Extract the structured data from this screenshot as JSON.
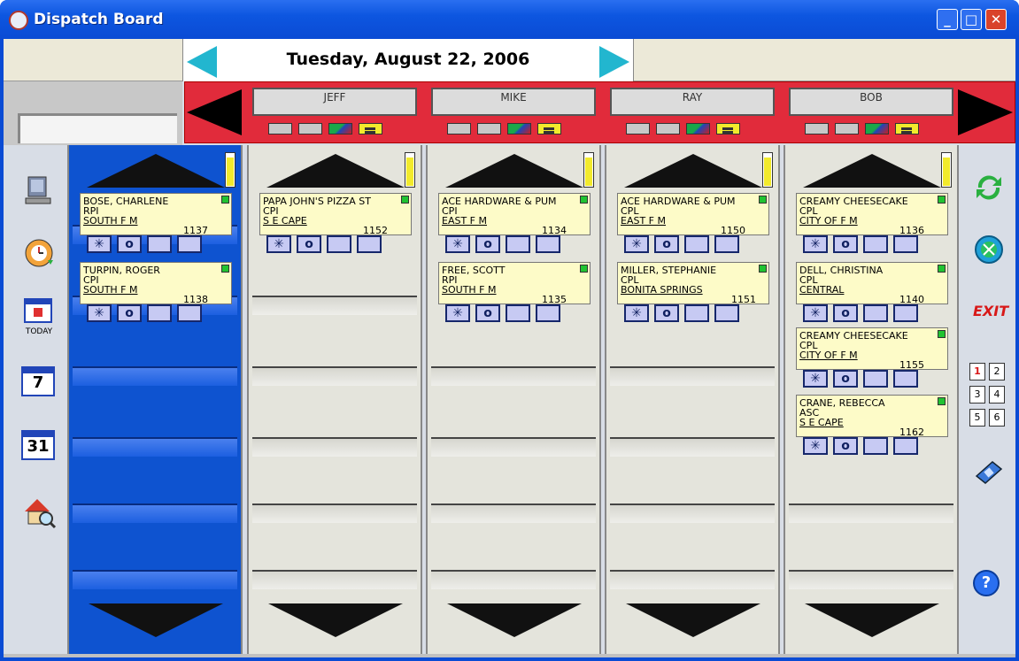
{
  "window": {
    "title": "Dispatch Board"
  },
  "date": {
    "text": "Tuesday, August 22, 2006"
  },
  "technicians": [
    {
      "name": "JEFF"
    },
    {
      "name": "MIKE"
    },
    {
      "name": "RAY"
    },
    {
      "name": "BOB"
    }
  ],
  "left_toolbar": {
    "today_label": "TODAY",
    "week_label": "7",
    "month_label": "31"
  },
  "right_toolbar": {
    "exit_label": "EXIT",
    "pages": [
      "1",
      "2",
      "3",
      "4",
      "5",
      "6"
    ],
    "help_label": "?"
  },
  "columns": [
    {
      "cards": [
        {
          "l1": "BOSE, CHARLENE",
          "l2": "RPI",
          "l3": "SOUTH F M",
          "num": "1137"
        },
        {
          "l1": "TURPIN, ROGER",
          "l2": "CPI",
          "l3": "SOUTH F M",
          "num": "1138"
        }
      ]
    },
    {
      "cards": [
        {
          "l1": "PAPA JOHN'S PIZZA ST",
          "l2": "CPI",
          "l3": "S E CAPE",
          "num": "1152"
        }
      ]
    },
    {
      "cards": [
        {
          "l1": "ACE HARDWARE & PUM",
          "l2": "CPI",
          "l3": "EAST F M",
          "num": "1134"
        },
        {
          "l1": "FREE, SCOTT",
          "l2": "RPI",
          "l3": "SOUTH F M",
          "num": "1135"
        }
      ]
    },
    {
      "cards": [
        {
          "l1": "ACE HARDWARE & PUM",
          "l2": "CPL",
          "l3": "EAST F M",
          "num": "1150"
        },
        {
          "l1": "MILLER, STEPHANIE",
          "l2": "CPL",
          "l3": "BONITA SPRINGS",
          "num": "1151"
        }
      ]
    },
    {
      "cards": [
        {
          "l1": "CREAMY CHEESECAKE",
          "l2": "CPL",
          "l3": "CITY OF F M",
          "num": "1136"
        },
        {
          "l1": "DELL, CHRISTINA",
          "l2": "CPL",
          "l3": "CENTRAL",
          "num": "1140"
        },
        {
          "l1": "CREAMY CHEESECAKE",
          "l2": "CPL",
          "l3": "CITY OF F M",
          "num": "1155"
        },
        {
          "l1": "CRANE, REBECCA",
          "l2": "ASC",
          "l3": "S E CAPE",
          "num": "1162"
        }
      ]
    }
  ],
  "action_labels": {
    "asterisk": "✳",
    "circle": "o"
  },
  "colors": {
    "active_column": "#0e53d0",
    "tech_bar": "#e12b3b",
    "card": "#fdfbc8",
    "flag": "#21c331"
  }
}
